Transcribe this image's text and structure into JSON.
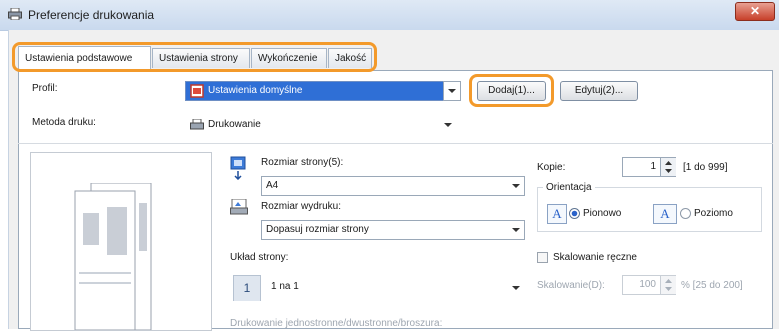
{
  "window": {
    "title": "Preferencje drukowania",
    "close_label": "✕"
  },
  "tabs": [
    {
      "label": "Ustawienia podstawowe",
      "active": true
    },
    {
      "label": "Ustawienia strony",
      "active": false
    },
    {
      "label": "Wykończenie",
      "active": false
    },
    {
      "label": "Jakość",
      "active": false
    }
  ],
  "profile": {
    "label": "Profil:",
    "value": "Ustawienia domyślne",
    "add_button": "Dodaj(1)...",
    "edit_button": "Edytuj(2)..."
  },
  "print_method": {
    "label": "Metoda druku:",
    "value": "Drukowanie"
  },
  "page_size": {
    "label": "Rozmiar strony(5):",
    "value": "A4"
  },
  "output_size": {
    "label": "Rozmiar wydruku:",
    "value": "Dopasuj rozmiar strony"
  },
  "copies": {
    "label": "Kopie:",
    "value": "1",
    "range": "[1 do 999]"
  },
  "orientation": {
    "label": "Orientacja",
    "portrait": "Pionowo",
    "landscape": "Poziomo",
    "selected": "portrait"
  },
  "layout": {
    "label": "Układ strony:",
    "value": "1 na 1",
    "icon_text": "1"
  },
  "manual_scaling": {
    "label": "Skalowanie ręczne",
    "checked": false
  },
  "scaling": {
    "label": "Skalowanie(D):",
    "value": "100",
    "range": "% [25 do 200]"
  },
  "duplex": {
    "label": "Drukowanie jednostronne/dwustronne/broszura:"
  },
  "colors": {
    "highlight": "#f39a2b",
    "profile_bg": "#2f6fd6",
    "radio_accent": "#2a62c9"
  }
}
